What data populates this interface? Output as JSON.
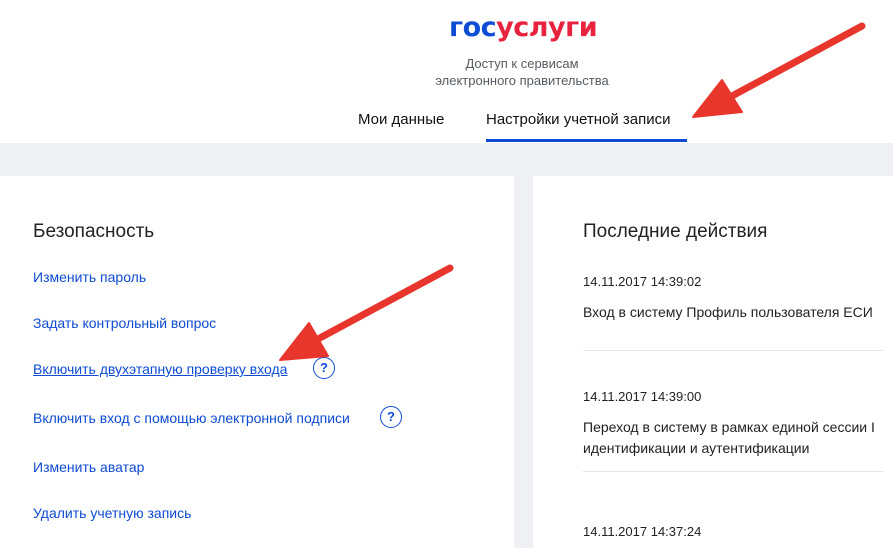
{
  "header": {
    "logo_part1": "гос",
    "logo_part2": "услуги",
    "tagline_line1": "Доступ к сервисам",
    "tagline_line2": "электронного правительства",
    "tabs": [
      {
        "label": "Мои данные",
        "active": false
      },
      {
        "label": "Настройки учетной записи",
        "active": true
      }
    ]
  },
  "security": {
    "title": "Безопасность",
    "links": [
      {
        "label": "Изменить пароль"
      },
      {
        "label": "Задать контрольный вопрос"
      },
      {
        "label": "Включить двухэтапную проверку входа",
        "help": "?"
      },
      {
        "label": "Включить вход с помощью электронной подписи",
        "help": "?"
      },
      {
        "label": "Изменить аватар"
      },
      {
        "label": "Удалить учетную запись"
      }
    ]
  },
  "recent": {
    "title": "Последние действия",
    "events": [
      {
        "time": "14.11.2017 14:39:02",
        "lines": [
          "Вход в систему Профиль пользователя ЕСИ"
        ]
      },
      {
        "time": "14.11.2017 14:39:00",
        "lines": [
          "Переход в систему в рамках единой сессии I",
          "идентификации и аутентификации"
        ]
      },
      {
        "time": "14.11.2017 14:37:24",
        "lines": []
      }
    ]
  },
  "colors": {
    "brand_blue": "#0d4cd3",
    "brand_red": "#e8233f",
    "annotation_arrow": "#e8362c",
    "page_background": "#eef0f3"
  },
  "icons": [
    "help-circle-icon",
    "annotation-arrow"
  ]
}
